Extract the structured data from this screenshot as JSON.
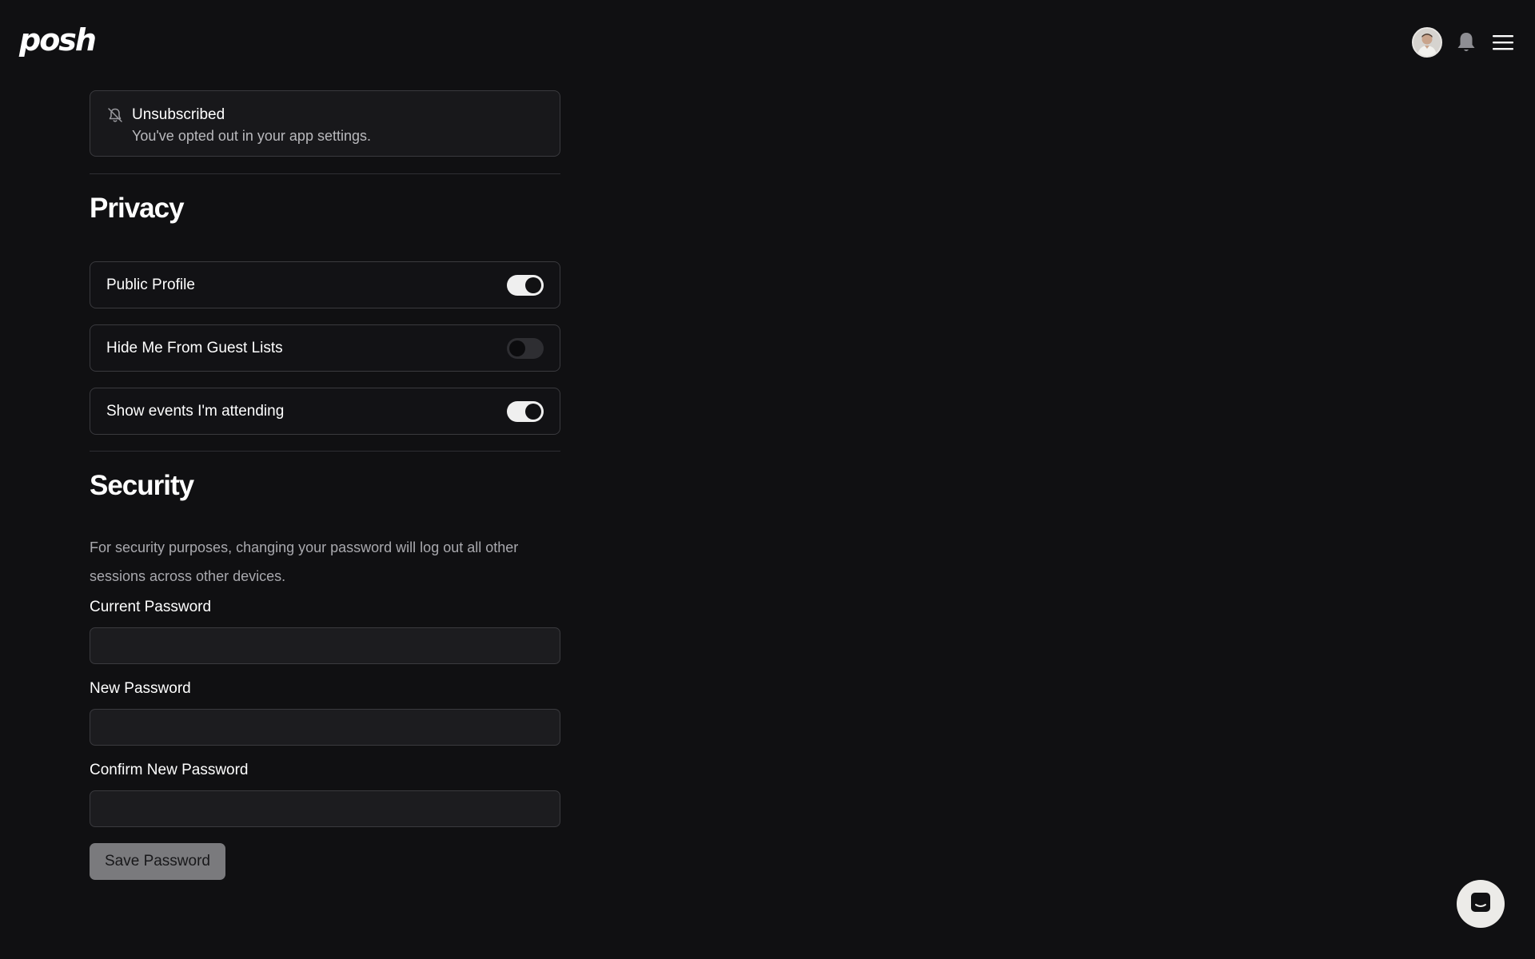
{
  "header": {
    "logo_text": "posh",
    "icons": [
      "avatar",
      "bell-icon",
      "hamburger-menu-icon"
    ]
  },
  "notifications": {
    "title": "Unsubscribed",
    "text": "You've opted out in your app settings.",
    "icon": "bell-off-icon"
  },
  "privacy": {
    "title": "Privacy",
    "toggles": [
      {
        "label": "Public Profile",
        "on": true
      },
      {
        "label": "Hide Me From Guest Lists",
        "on": false
      },
      {
        "label": "Show events I'm attending",
        "on": true
      }
    ]
  },
  "security": {
    "title": "Security",
    "description": "For security purposes, changing your password will log out all other sessions across other devices.",
    "current_password_label": "Current Password",
    "current_password_value": "",
    "new_password_label": "New Password",
    "new_password_value": "",
    "confirm_password_label": "Confirm New Password",
    "confirm_password_value": "",
    "save_label": "Save Password"
  },
  "colors": {
    "background": "#101012",
    "toggle_on": "#efefef",
    "toggle_off": "#2e2e32",
    "save_button": "#7a7a7d"
  },
  "chat": {
    "icon": "chat-icon"
  }
}
